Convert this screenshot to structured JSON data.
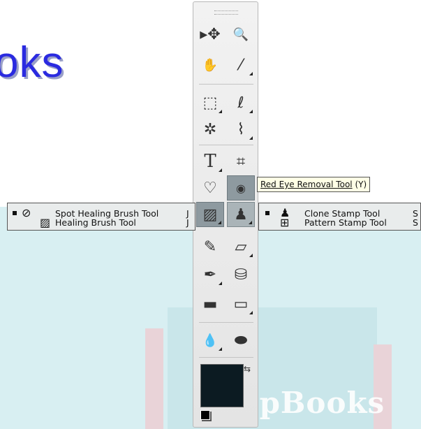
{
  "heading": "oks",
  "watermark": "DropBooks",
  "tooltip": {
    "name": "Red Eye Removal Tool",
    "shortcut": "(Y)"
  },
  "left_menu": {
    "items": [
      {
        "label": "Spot Healing Brush Tool",
        "key": "J",
        "selected": true,
        "icon": "spot-healing-brush-icon"
      },
      {
        "label": "Healing Brush Tool",
        "key": "J",
        "selected": false,
        "icon": "healing-brush-icon"
      }
    ]
  },
  "right_menu": {
    "items": [
      {
        "label": "Clone Stamp Tool",
        "key": "S",
        "selected": true,
        "icon": "clone-stamp-icon"
      },
      {
        "label": "Pattern Stamp Tool",
        "key": "S",
        "selected": false,
        "icon": "pattern-stamp-icon"
      }
    ]
  },
  "toolbox": {
    "glyphs": {
      "move": "▸✥",
      "zoom": "🔍",
      "hand": "✋",
      "eyedropper": "⁄",
      "marquee": "⬚",
      "lasso": "ℓ",
      "magic_wand": "✲",
      "quick_select": "⌇",
      "type": "T",
      "crop": "⌗",
      "red_eye_patch": "♡",
      "red_eye": "◉",
      "healing": "▨",
      "stamp": "♟",
      "pencil": "✎",
      "eraser": "▱",
      "brush": "✒",
      "bucket": "⛁",
      "gradient": "▬",
      "shape": "▭",
      "blur": "💧",
      "sponge": "⬬",
      "swap": "⇆"
    },
    "colors": {
      "foreground": "#0c1b22"
    }
  },
  "colors": {
    "heading": "#2a2ae0",
    "menu_bg": "#e9ecec",
    "watermark_panel": "#d8eff2"
  }
}
